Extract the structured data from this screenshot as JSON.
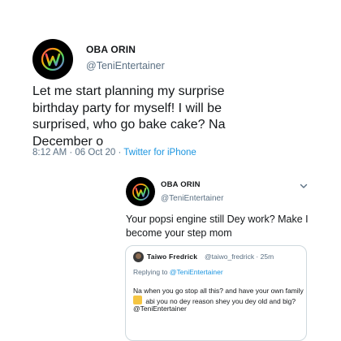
{
  "main_tweet": {
    "name": "OBA ORIN",
    "handle": "@TeniEntertainer",
    "text": "Let me start planning my surprise birthday party for myself! I will be surprised, who go bake cake? Na December o",
    "time": "8:12 AM · 06 Oct 20 · ",
    "client": "Twitter for iPhone"
  },
  "reply_tweet": {
    "name": "OBA ORIN",
    "handle": "@TeniEntertainer",
    "text": "Your popsi engine still Dey work? Make I become your step mom",
    "menu_icon": "chevron-down-icon"
  },
  "quoted_tweet": {
    "name": "Taiwo Fredrick",
    "handle": "@taiwo_fredrick · 25m",
    "replying_prefix": "Replying to ",
    "replying_to": "@TeniEntertainer",
    "line1": "Na when you go stop all this? and have your own family",
    "line2": " abi you no dey reason shey you dey old and big?",
    "line3": "@TeniEntertainer",
    "emoji_icon": "emoji-icon"
  },
  "colors": {
    "accent": "#1b95e0",
    "muted": "#5b7083",
    "text": "#14171a",
    "border": "#cfd9de"
  }
}
